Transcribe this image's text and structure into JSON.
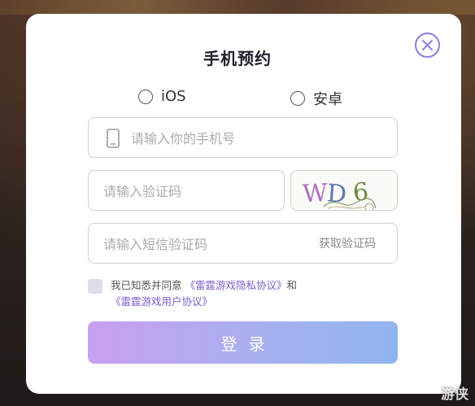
{
  "dialog": {
    "title": "手机预约",
    "radio_options": [
      {
        "label": "iOS",
        "selected": false
      },
      {
        "label": "安卓",
        "selected": false
      }
    ],
    "phone_field": {
      "placeholder": "请输入你的手机号",
      "icon": "phone-icon"
    },
    "captcha_field": {
      "placeholder": "请输入验证码"
    },
    "captcha_image": {
      "text": "WD6"
    },
    "sms_field": {
      "placeholder": "请输入短信验证码",
      "action_label": "获取验证码"
    },
    "agreement": {
      "checked": false,
      "prefix": "我已知悉并同意",
      "privacy_link": "《雷霆游戏隐私协议》",
      "conjunction": "和",
      "user_link": "《雷霆游戏用户协议》"
    },
    "submit_label": "登录",
    "close_icon": "close-circle-icon"
  },
  "watermark": "游侠",
  "colors": {
    "accent": "#8a7fe0",
    "link": "#7b5bd0",
    "button_gradient_start": "#c8a0f0",
    "button_gradient_end": "#90b4f0"
  }
}
